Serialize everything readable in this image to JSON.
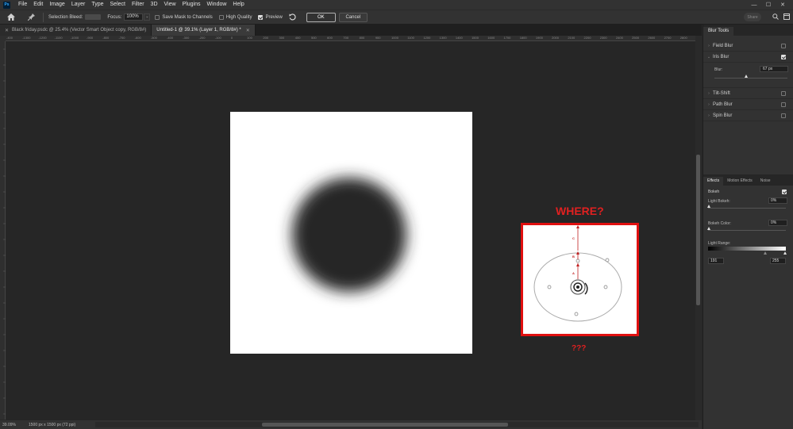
{
  "menubar": {
    "logo": "Ps",
    "items": [
      "File",
      "Edit",
      "Image",
      "Layer",
      "Type",
      "Select",
      "Filter",
      "3D",
      "View",
      "Plugins",
      "Window",
      "Help"
    ],
    "window_controls": [
      "—",
      "☐",
      "✕"
    ]
  },
  "options": {
    "selection_bleed_label": "Selection Bleed:",
    "focus_label": "Focus:",
    "focus_value": "100%",
    "save_mask_label": "Save Mask to Channels",
    "high_quality_label": "High Quality",
    "preview_label": "Preview",
    "preview_checked": true,
    "ok_label": "OK",
    "cancel_label": "Cancel",
    "share_label": "Share"
  },
  "tabs": [
    {
      "label": "Black friday.psdc @ 25.4% (Vector Smart Object copy, RGB/8#)",
      "active": false
    },
    {
      "label": "Untitled-1 @ 39.1% (Layer 1, RGB/8#) *",
      "active": true
    }
  ],
  "ruler_top_labels": [
    "-400",
    "-1300",
    "-1200",
    "-1100",
    "-1000",
    "-900",
    "-800",
    "-700",
    "-600",
    "-500",
    "-400",
    "-300",
    "-200",
    "-100",
    "0",
    "100",
    "200",
    "300",
    "400",
    "500",
    "600",
    "700",
    "800",
    "900",
    "1000",
    "1100",
    "1200",
    "1300",
    "1400",
    "1500",
    "1600",
    "1700",
    "1800",
    "1900",
    "2000",
    "2100",
    "2200",
    "2300",
    "2400",
    "2500",
    "2600",
    "2700",
    "2800"
  ],
  "status": {
    "zoom": "39.09%",
    "doc_size": "1500 px x 1500 px (72 ppi)",
    "arrow": "›"
  },
  "blur_tools": {
    "title": "Blur Tools",
    "items": [
      {
        "label": "Field Blur",
        "checked": false
      },
      {
        "label": "Iris Blur",
        "checked": true
      },
      {
        "label": "Tilt-Shift",
        "checked": false
      },
      {
        "label": "Path Blur",
        "checked": false
      },
      {
        "label": "Spin Blur",
        "checked": false
      }
    ],
    "blur_label": "Blur:",
    "blur_value": "67 px"
  },
  "effects": {
    "tabs": [
      "Effects",
      "Motion Effects",
      "Noise"
    ],
    "bokeh_label": "Bokeh",
    "bokeh_checked": true,
    "light_bokeh_label": "Light Bokeh:",
    "light_bokeh_value": "0%",
    "bokeh_color_label": "Bokeh Color:",
    "bokeh_color_value": "0%",
    "light_range_label": "Light Range:",
    "range_low": "191",
    "range_high": "255"
  },
  "annotation": {
    "heading": "WHERE?",
    "footer": "???",
    "markers": [
      "C",
      "B",
      "A"
    ],
    "accent": "#e01010"
  }
}
